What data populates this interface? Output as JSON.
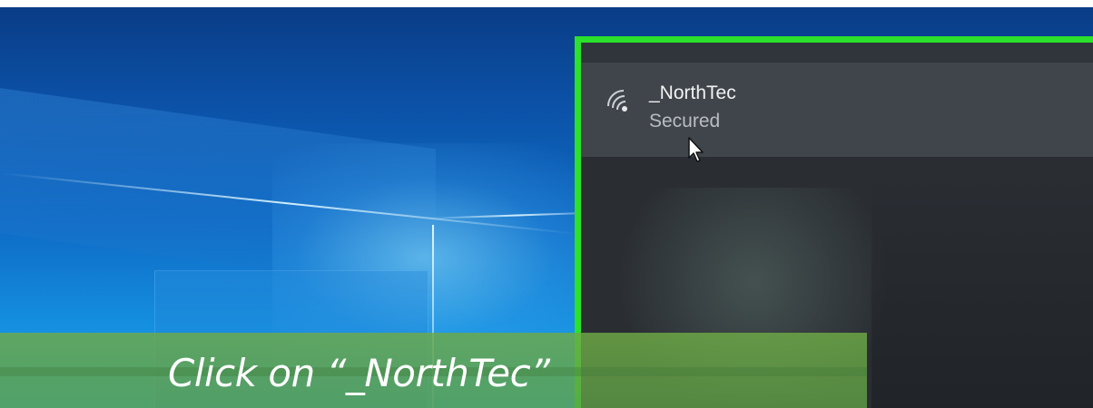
{
  "network_flyout": {
    "network": {
      "ssid": "_NorthTec",
      "status": "Secured",
      "icon": "wifi-secured-icon"
    },
    "highlight_color": "#2be12b"
  },
  "caption": {
    "text": "Click on “_NorthTec”"
  },
  "colors": {
    "flyout_background": "#2a2e33",
    "selected_item_background": "#40454b",
    "caption_band": "#6eaa46"
  }
}
